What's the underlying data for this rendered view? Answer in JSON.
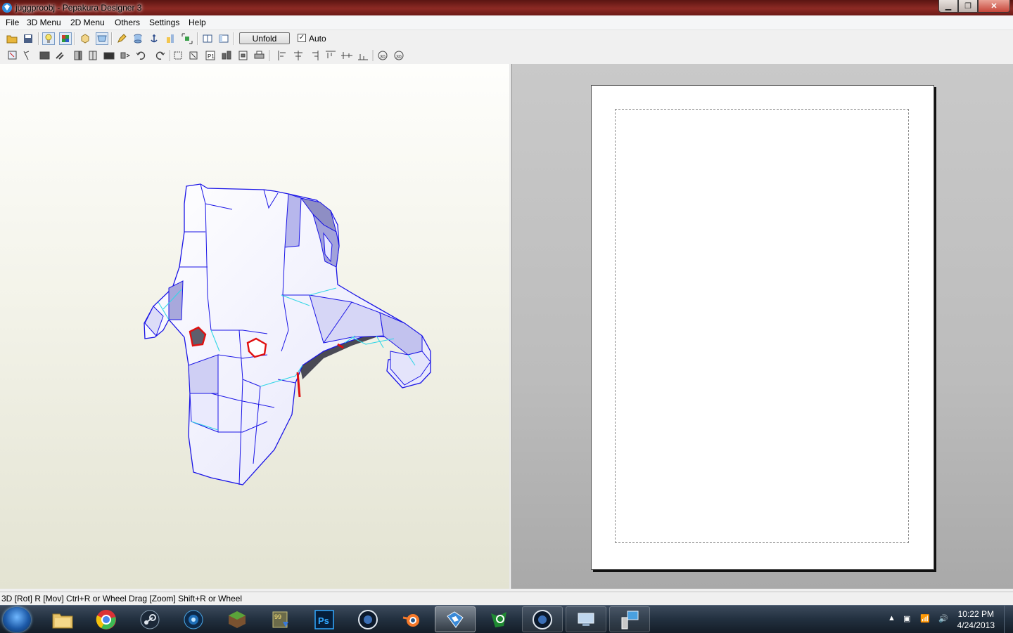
{
  "window": {
    "title": "juggproobj - Pepakura Designer 3",
    "buttons": [
      "minimize",
      "maximize",
      "close"
    ]
  },
  "menu": [
    "File",
    "3D Menu",
    "2D Menu",
    "Others",
    "Settings",
    "Help"
  ],
  "toolbar": {
    "unfold_label": "Unfold",
    "auto_label": "Auto",
    "auto_checked": true
  },
  "status": {
    "text": "3D [Rot] R [Mov] Ctrl+R or Wheel Drag [Zoom] Shift+R or Wheel"
  },
  "taskbar": {
    "apps": [
      "start-orb",
      "file-explorer",
      "chrome",
      "steam",
      "media-player",
      "minecraft",
      "game-launcher",
      "photoshop",
      "cinema4d",
      "blender",
      "pepakura",
      "reader",
      "cinema4d-2",
      "remote-desktop",
      "network-tool"
    ],
    "clock_time": "10:22 PM",
    "clock_date": "4/24/2013"
  },
  "colors": {
    "mesh_face": "#f0f0ff",
    "mesh_edge": "#1a14e6",
    "fold_edge": "#33d6e6",
    "cut_edge": "#e01010",
    "shadow_face": "#5e5e6c"
  }
}
